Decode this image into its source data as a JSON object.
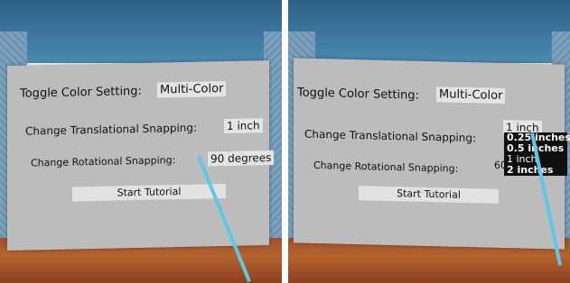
{
  "left_view": {
    "toggle_color_label": "Toggle Color Setting:",
    "toggle_color_value": "Multi-Color",
    "translational_label": "Change Translational Snapping:",
    "translational_value": "1 inch",
    "rotational_label": "Change Rotational Snapping:",
    "rotational_value": "90 degrees",
    "tutorial_label": "Start Tutorial"
  },
  "right_view": {
    "toggle_color_label": "Toggle Color Setting:",
    "toggle_color_value": "Multi-Color",
    "translational_label": "Change Translational Snapping:",
    "translational_value": "1 inch",
    "rotational_label": "Change Rotational Snapping:",
    "rotational_value_partial": "60",
    "tutorial_label": "Start Tutorial",
    "dropdown_options": [
      "0.25 inches",
      "0.5 inches",
      "1 inch",
      "2 inches"
    ]
  },
  "colors": {
    "panel": "#bcbcbc",
    "value_box": "#e4e4e4",
    "dropdown_bg": "#0f0f0f",
    "pointer_ray": "#5bc8e8"
  },
  "icons": [
    "pointer-ray"
  ]
}
